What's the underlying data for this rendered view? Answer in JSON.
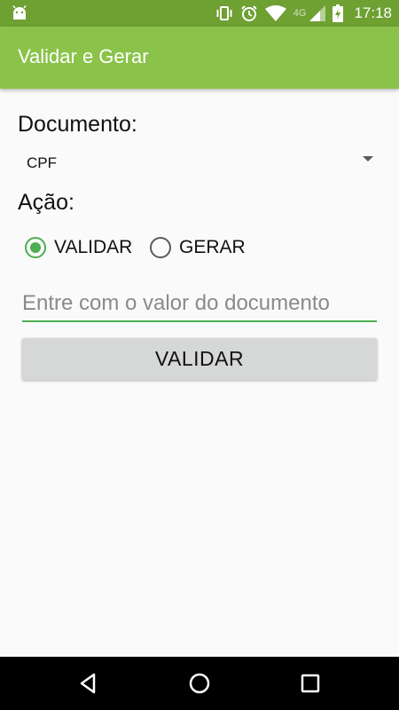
{
  "status_bar": {
    "network": "4G",
    "time": "17:18",
    "icons": [
      "android-icon",
      "vibrate-icon",
      "alarm-icon",
      "wifi-icon",
      "signal-icon",
      "battery-charging-icon"
    ]
  },
  "app_bar": {
    "title": "Validar e Gerar",
    "color": "#8bc34a",
    "status_color": "#6ea032"
  },
  "form": {
    "document_label": "Documento:",
    "document_selected": "CPF",
    "action_label": "Ação:",
    "actions": [
      {
        "label": "VALIDAR",
        "checked": true
      },
      {
        "label": "GERAR",
        "checked": false
      }
    ],
    "input_placeholder": "Entre com o valor do documento",
    "input_value": "",
    "accent": "#4caf50",
    "button_label": "VALIDAR"
  },
  "nav_bar": {
    "icons": [
      "back-icon",
      "home-icon",
      "recents-icon"
    ]
  }
}
